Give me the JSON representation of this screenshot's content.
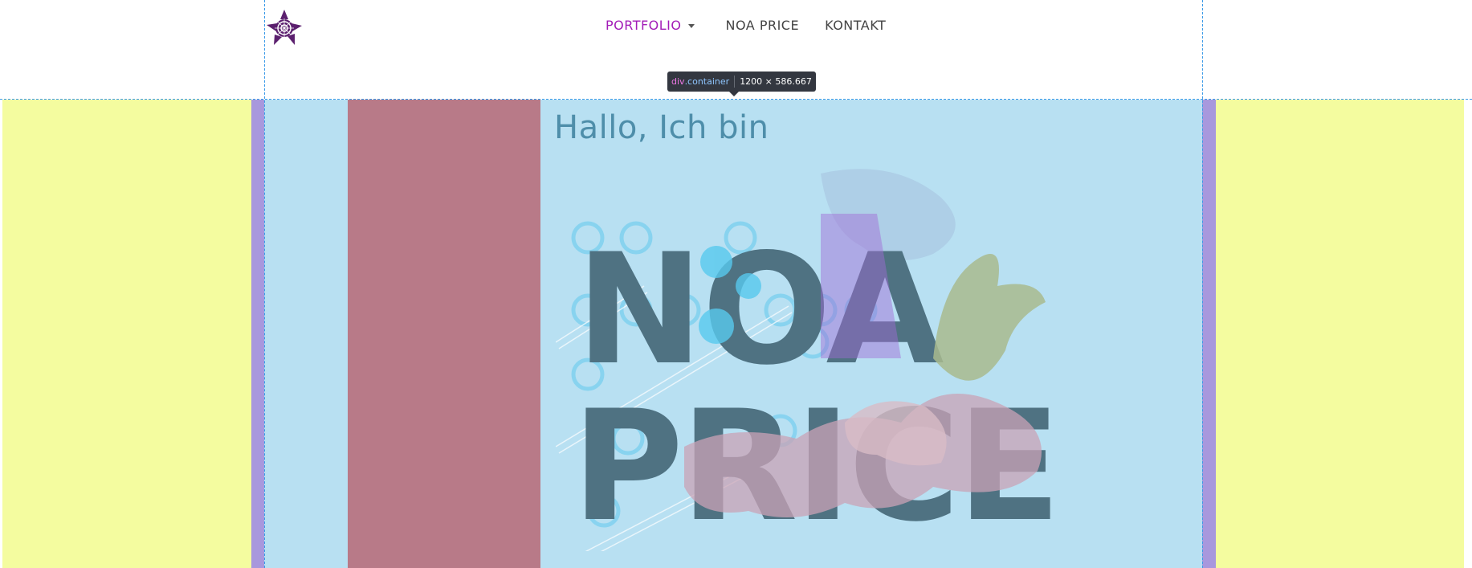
{
  "nav": {
    "items": [
      {
        "label": "PORTFOLIO",
        "active": true
      },
      {
        "label": "NOA PRICE"
      },
      {
        "label": "KONTAKT"
      }
    ]
  },
  "devtools_tooltip": {
    "tag": "div",
    "class": ".container",
    "size": "1200 × 586.667"
  },
  "hero": {
    "greeting": "Hallo, Ich bin",
    "name_line1": "NOA",
    "name_line2": "PRICE"
  },
  "colors": {
    "accent": "#a31cb8",
    "margin_overlay": "#f4fc9f",
    "padding_overlay": "#a898dd",
    "content_overlay": "#b8e0f2",
    "column_overlay": "#b87a88",
    "title_text": "#4e8eaa"
  },
  "icons": [
    "flower-logo-icon",
    "caret-down-icon"
  ]
}
